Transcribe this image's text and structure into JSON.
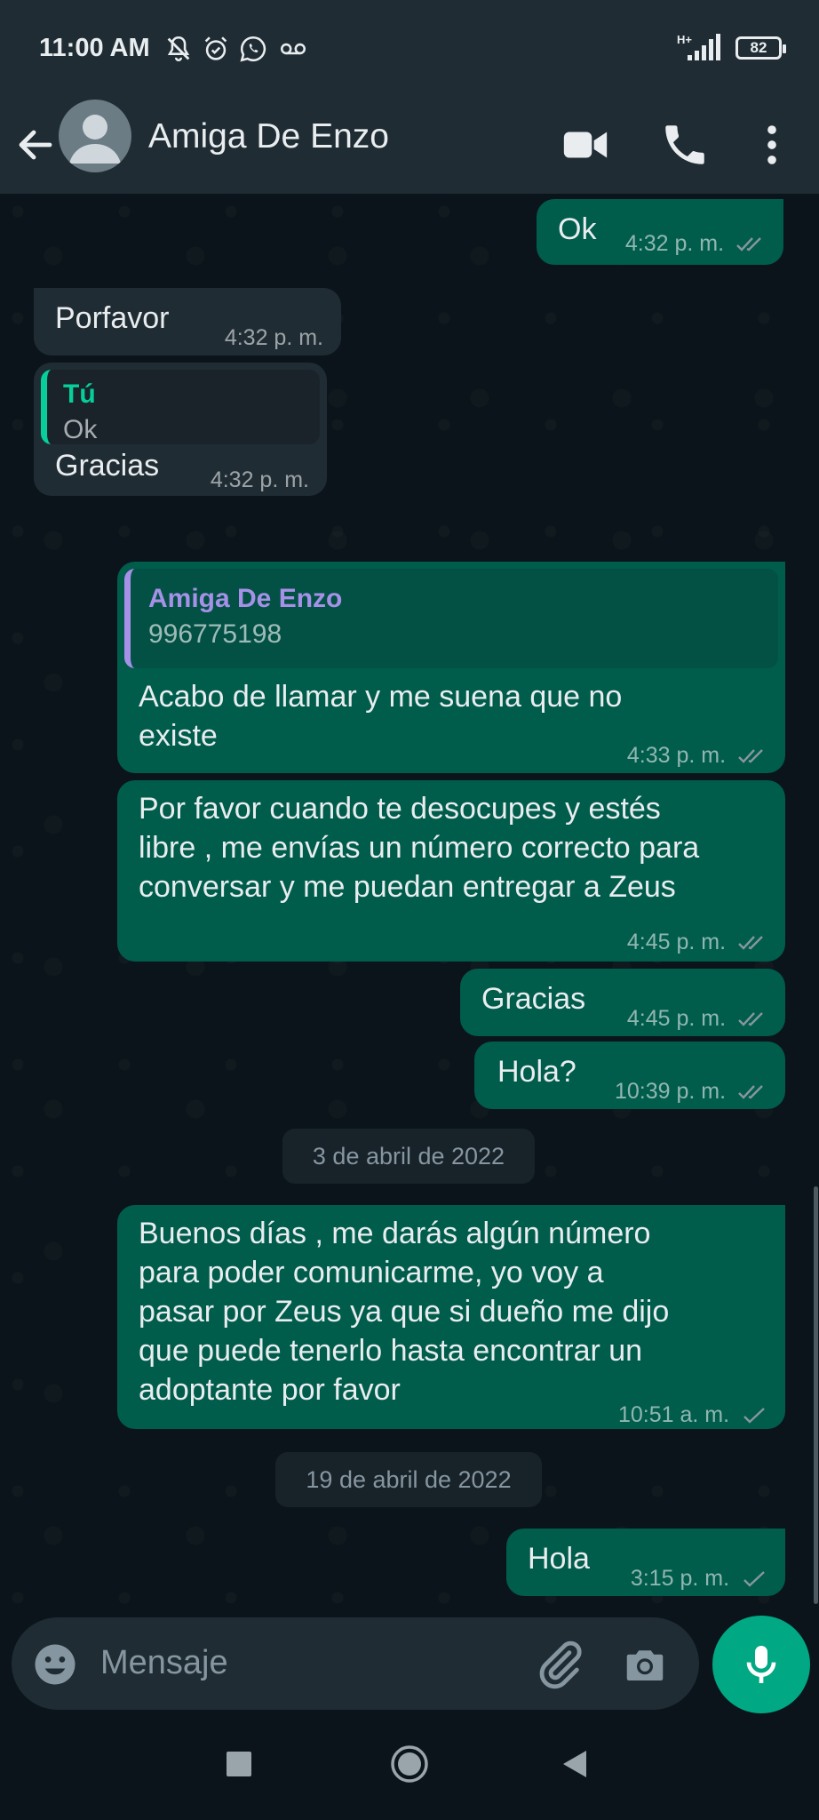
{
  "status_bar": {
    "time": "11:00 AM",
    "network": "H+",
    "battery": "82",
    "icons": [
      "muted-notification-icon",
      "alarm-icon",
      "whatsapp-icon",
      "voicemail-icon",
      "signal-icon",
      "battery-icon"
    ]
  },
  "header": {
    "contact_name": "Amiga De Enzo",
    "icons": [
      "back-arrow-icon",
      "video-call-icon",
      "voice-call-icon",
      "more-options-icon"
    ]
  },
  "messages": [
    {
      "direction": "out",
      "text": "Ok",
      "time": "4:32 p. m.",
      "status": "read"
    },
    {
      "direction": "in",
      "text": "Porfavor",
      "time": "4:32 p. m."
    },
    {
      "direction": "in",
      "quote": {
        "author": "Tú",
        "text": "Ok"
      },
      "text": "Gracias",
      "time": "4:32 p. m."
    },
    {
      "direction": "out",
      "quote": {
        "author": "Amiga De Enzo",
        "text": "996775198"
      },
      "lines": [
        "Acabo de llamar y me suena que no",
        "existe"
      ],
      "time": "4:33 p. m.",
      "status": "read"
    },
    {
      "direction": "out",
      "lines": [
        "Por favor cuando te desocupes y estés",
        "libre , me envías un número correcto para",
        "conversar y me puedan entregar a Zeus"
      ],
      "time": "4:45 p. m.",
      "status": "read"
    },
    {
      "direction": "out",
      "text": "Gracias",
      "time": "4:45 p. m.",
      "status": "read"
    },
    {
      "direction": "out",
      "text": "Hola?",
      "time": "10:39 p. m.",
      "status": "read"
    },
    {
      "direction": "out",
      "lines": [
        "Buenos días ,  me darás algún número",
        "para poder comunicarme, yo voy a",
        "pasar por Zeus ya que si dueño me dijo",
        "que puede tenerlo hasta encontrar un",
        "adoptante por favor"
      ],
      "time": "10:51 a. m.",
      "status": "sent"
    },
    {
      "direction": "out",
      "text": "Hola",
      "time": "3:15 p. m.",
      "status": "sent"
    }
  ],
  "date_separators": [
    "3 de abril de 2022",
    "19 de abril de 2022"
  ],
  "composer": {
    "placeholder": "Mensaje",
    "icons": [
      "emoji-icon",
      "attach-icon",
      "camera-icon",
      "mic-icon"
    ]
  },
  "navigation": {
    "icons": [
      "recents-square-icon",
      "home-circle-icon",
      "back-triangle-icon"
    ]
  },
  "colors": {
    "header_bg": "#1f2c34",
    "chat_bg": "#0b141a",
    "outgoing_bubble": "#005c4b",
    "incoming_bubble": "#202c33",
    "accent": "#00a884",
    "read_tick": "#8696a0"
  }
}
